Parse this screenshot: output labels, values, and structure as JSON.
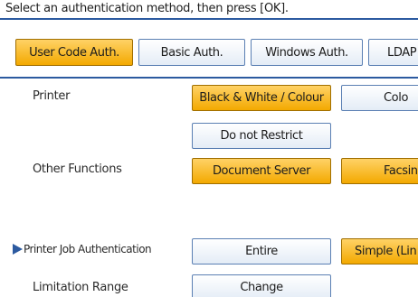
{
  "instruction": "Select an authentication method, then press [OK].",
  "auth_tabs": [
    {
      "label": "User Code Auth.",
      "selected": true
    },
    {
      "label": "Basic Auth.",
      "selected": false
    },
    {
      "label": "Windows Auth.",
      "selected": false
    },
    {
      "label": "LDAP",
      "selected": false
    }
  ],
  "printer": {
    "label": "Printer",
    "options": [
      "Black & White / Colour",
      "Colo",
      "Do not Restrict"
    ],
    "selected": "Black & White / Colour"
  },
  "other_functions": {
    "label": "Other Functions",
    "options": [
      "Document Server",
      "Facsin"
    ],
    "selected": [
      "Document Server",
      "Facsin"
    ]
  },
  "printer_job_auth": {
    "label": "Printer Job Authentication",
    "options": [
      "Entire",
      "Simple (Lin"
    ],
    "selected": "Simple (Lin"
  },
  "limitation_range": {
    "label": "Limitation Range",
    "button": "Change"
  },
  "colors": {
    "accent_blue": "#2c5aa0",
    "selected_orange": "#f3a900",
    "button_border": "#5a7fb3"
  },
  "icons": {
    "current_item_marker": "right-triangle-marker"
  }
}
